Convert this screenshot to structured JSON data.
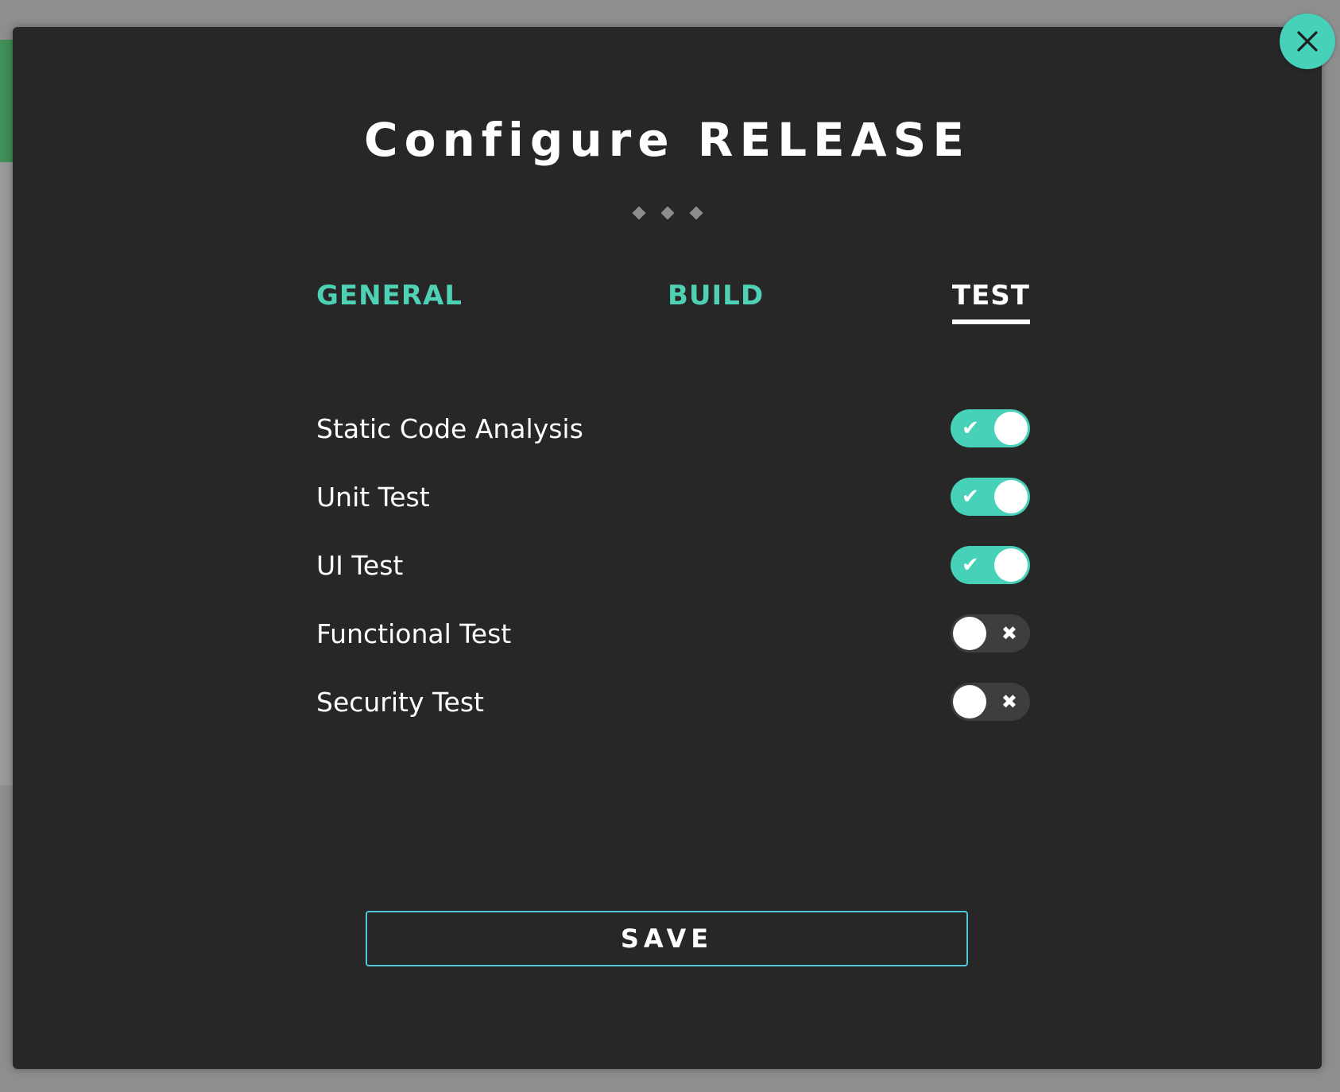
{
  "modal": {
    "title": "Configure RELEASE",
    "steps": 3
  },
  "tabs": [
    {
      "label": "GENERAL",
      "active": false
    },
    {
      "label": "BUILD",
      "active": false
    },
    {
      "label": "TEST",
      "active": true
    }
  ],
  "options": [
    {
      "label": "Static Code Analysis",
      "enabled": true
    },
    {
      "label": "Unit Test",
      "enabled": true
    },
    {
      "label": "UI Test",
      "enabled": true
    },
    {
      "label": "Functional Test",
      "enabled": false
    },
    {
      "label": "Security Test",
      "enabled": false
    }
  ],
  "save_button": {
    "label": "SAVE"
  },
  "close_button": {
    "icon": "close-icon"
  },
  "colors": {
    "accent": "#47d1b8",
    "modal_bg": "#272727",
    "save_border": "#4fc8d8"
  }
}
